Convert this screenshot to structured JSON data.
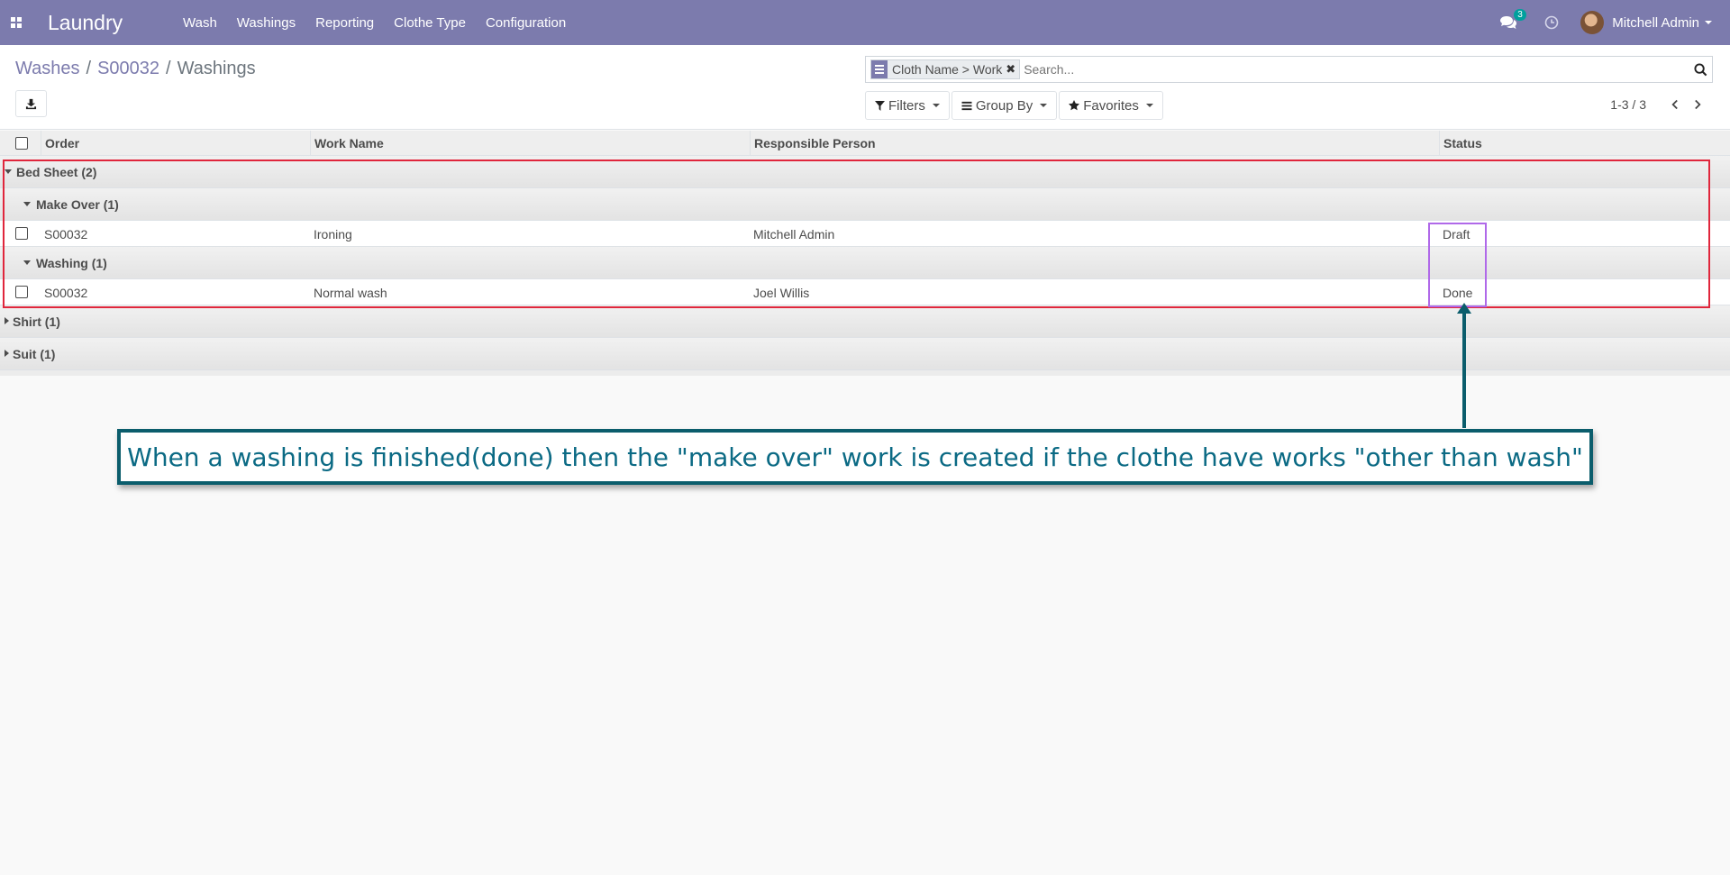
{
  "navbar": {
    "brand": "Laundry",
    "menu": [
      "Wash",
      "Washings",
      "Reporting",
      "Clothe Type",
      "Configuration"
    ],
    "chat_badge": "3",
    "user_name": "Mitchell Admin"
  },
  "breadcrumb": [
    "Washes",
    "S00032",
    "Washings"
  ],
  "breadcrumb_sep": "/",
  "search": {
    "facet": "Cloth Name > Work",
    "placeholder": "Search..."
  },
  "filters_label": "Filters",
  "groupby_label": "Group By",
  "favorites_label": "Favorites",
  "pager": "1-3 / 3",
  "columns": [
    "Order",
    "Work Name",
    "Responsible Person",
    "Status"
  ],
  "groups": [
    {
      "label": "Bed Sheet (2)",
      "subgroups": [
        {
          "label": "Make Over (1)",
          "rows": [
            {
              "order": "S00032",
              "work": "Ironing",
              "person": "Mitchell Admin",
              "status": "Draft"
            }
          ]
        },
        {
          "label": "Washing (1)",
          "rows": [
            {
              "order": "S00032",
              "work": "Normal wash",
              "person": "Joel Willis",
              "status": "Done"
            }
          ]
        }
      ]
    },
    {
      "label": "Shirt (1)"
    },
    {
      "label": "Suit (1)"
    }
  ],
  "annotation": "When a washing is finished(done) then the \"make over\" work is created if the clothe have works \"other than wash\"",
  "colors": {
    "navbar": "#7c7bad",
    "annotation_border": "#0b5d6c",
    "highlight_red": "#e0263c",
    "highlight_purple": "#b069e9"
  }
}
